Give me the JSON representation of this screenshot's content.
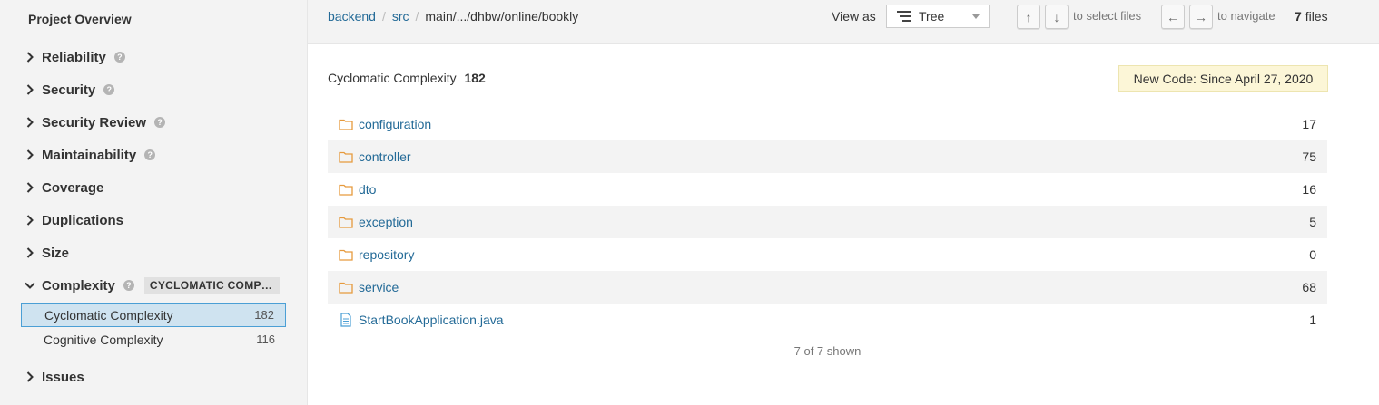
{
  "sidebar": {
    "title": "Project Overview",
    "domains": [
      {
        "label": "Reliability",
        "help": true
      },
      {
        "label": "Security",
        "help": true
      },
      {
        "label": "Security Review",
        "help": true
      },
      {
        "label": "Maintainability",
        "help": true
      },
      {
        "label": "Coverage",
        "help": false
      },
      {
        "label": "Duplications",
        "help": false
      },
      {
        "label": "Size",
        "help": false
      },
      {
        "label": "Complexity",
        "help": true,
        "expanded": true,
        "badge": "CYCLOMATIC COMPLEXITY"
      },
      {
        "label": "Issues",
        "help": false
      }
    ],
    "complexity_metrics": [
      {
        "label": "Cyclomatic Complexity",
        "value": "182",
        "selected": true
      },
      {
        "label": "Cognitive Complexity",
        "value": "116",
        "selected": false
      }
    ]
  },
  "breadcrumb": {
    "items": [
      "backend",
      "src"
    ],
    "current": "main/.../dhbw/online/bookly"
  },
  "toolbar": {
    "view_as_label": "View as",
    "view_mode": "Tree",
    "up_key": "↑",
    "down_key": "↓",
    "select_hint": "to select files",
    "left_key": "←",
    "right_key": "→",
    "navigate_hint": "to navigate",
    "files_count": "7",
    "files_label": "files"
  },
  "main": {
    "metric_label": "Cyclomatic Complexity",
    "metric_value": "182",
    "new_code": "New Code: Since April 27, 2020",
    "rows": [
      {
        "name": "configuration",
        "value": "17",
        "kind": "folder"
      },
      {
        "name": "controller",
        "value": "75",
        "kind": "folder"
      },
      {
        "name": "dto",
        "value": "16",
        "kind": "folder"
      },
      {
        "name": "exception",
        "value": "5",
        "kind": "folder"
      },
      {
        "name": "repository",
        "value": "0",
        "kind": "folder"
      },
      {
        "name": "service",
        "value": "68",
        "kind": "folder"
      },
      {
        "name": "StartBookApplication.java",
        "value": "1",
        "kind": "file"
      }
    ],
    "shown": "7 of 7 shown"
  },
  "colors": {
    "link": "#236a97",
    "folder": "#e69a3d",
    "selected_bg": "#cfe3f0",
    "selected_border": "#4b9fd5",
    "new_code_bg": "#fcf6d7"
  }
}
